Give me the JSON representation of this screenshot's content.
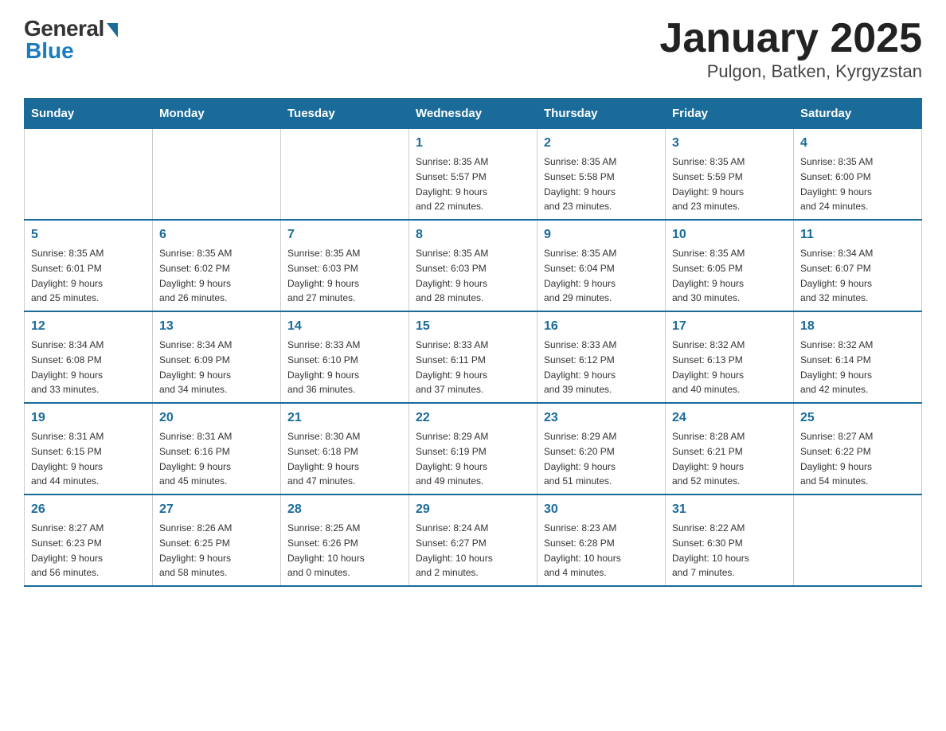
{
  "logo": {
    "general": "General",
    "blue": "Blue"
  },
  "title": "January 2025",
  "subtitle": "Pulgon, Batken, Kyrgyzstan",
  "days_of_week": [
    "Sunday",
    "Monday",
    "Tuesday",
    "Wednesday",
    "Thursday",
    "Friday",
    "Saturday"
  ],
  "weeks": [
    [
      {
        "day": "",
        "info": ""
      },
      {
        "day": "",
        "info": ""
      },
      {
        "day": "",
        "info": ""
      },
      {
        "day": "1",
        "info": "Sunrise: 8:35 AM\nSunset: 5:57 PM\nDaylight: 9 hours\nand 22 minutes."
      },
      {
        "day": "2",
        "info": "Sunrise: 8:35 AM\nSunset: 5:58 PM\nDaylight: 9 hours\nand 23 minutes."
      },
      {
        "day": "3",
        "info": "Sunrise: 8:35 AM\nSunset: 5:59 PM\nDaylight: 9 hours\nand 23 minutes."
      },
      {
        "day": "4",
        "info": "Sunrise: 8:35 AM\nSunset: 6:00 PM\nDaylight: 9 hours\nand 24 minutes."
      }
    ],
    [
      {
        "day": "5",
        "info": "Sunrise: 8:35 AM\nSunset: 6:01 PM\nDaylight: 9 hours\nand 25 minutes."
      },
      {
        "day": "6",
        "info": "Sunrise: 8:35 AM\nSunset: 6:02 PM\nDaylight: 9 hours\nand 26 minutes."
      },
      {
        "day": "7",
        "info": "Sunrise: 8:35 AM\nSunset: 6:03 PM\nDaylight: 9 hours\nand 27 minutes."
      },
      {
        "day": "8",
        "info": "Sunrise: 8:35 AM\nSunset: 6:03 PM\nDaylight: 9 hours\nand 28 minutes."
      },
      {
        "day": "9",
        "info": "Sunrise: 8:35 AM\nSunset: 6:04 PM\nDaylight: 9 hours\nand 29 minutes."
      },
      {
        "day": "10",
        "info": "Sunrise: 8:35 AM\nSunset: 6:05 PM\nDaylight: 9 hours\nand 30 minutes."
      },
      {
        "day": "11",
        "info": "Sunrise: 8:34 AM\nSunset: 6:07 PM\nDaylight: 9 hours\nand 32 minutes."
      }
    ],
    [
      {
        "day": "12",
        "info": "Sunrise: 8:34 AM\nSunset: 6:08 PM\nDaylight: 9 hours\nand 33 minutes."
      },
      {
        "day": "13",
        "info": "Sunrise: 8:34 AM\nSunset: 6:09 PM\nDaylight: 9 hours\nand 34 minutes."
      },
      {
        "day": "14",
        "info": "Sunrise: 8:33 AM\nSunset: 6:10 PM\nDaylight: 9 hours\nand 36 minutes."
      },
      {
        "day": "15",
        "info": "Sunrise: 8:33 AM\nSunset: 6:11 PM\nDaylight: 9 hours\nand 37 minutes."
      },
      {
        "day": "16",
        "info": "Sunrise: 8:33 AM\nSunset: 6:12 PM\nDaylight: 9 hours\nand 39 minutes."
      },
      {
        "day": "17",
        "info": "Sunrise: 8:32 AM\nSunset: 6:13 PM\nDaylight: 9 hours\nand 40 minutes."
      },
      {
        "day": "18",
        "info": "Sunrise: 8:32 AM\nSunset: 6:14 PM\nDaylight: 9 hours\nand 42 minutes."
      }
    ],
    [
      {
        "day": "19",
        "info": "Sunrise: 8:31 AM\nSunset: 6:15 PM\nDaylight: 9 hours\nand 44 minutes."
      },
      {
        "day": "20",
        "info": "Sunrise: 8:31 AM\nSunset: 6:16 PM\nDaylight: 9 hours\nand 45 minutes."
      },
      {
        "day": "21",
        "info": "Sunrise: 8:30 AM\nSunset: 6:18 PM\nDaylight: 9 hours\nand 47 minutes."
      },
      {
        "day": "22",
        "info": "Sunrise: 8:29 AM\nSunset: 6:19 PM\nDaylight: 9 hours\nand 49 minutes."
      },
      {
        "day": "23",
        "info": "Sunrise: 8:29 AM\nSunset: 6:20 PM\nDaylight: 9 hours\nand 51 minutes."
      },
      {
        "day": "24",
        "info": "Sunrise: 8:28 AM\nSunset: 6:21 PM\nDaylight: 9 hours\nand 52 minutes."
      },
      {
        "day": "25",
        "info": "Sunrise: 8:27 AM\nSunset: 6:22 PM\nDaylight: 9 hours\nand 54 minutes."
      }
    ],
    [
      {
        "day": "26",
        "info": "Sunrise: 8:27 AM\nSunset: 6:23 PM\nDaylight: 9 hours\nand 56 minutes."
      },
      {
        "day": "27",
        "info": "Sunrise: 8:26 AM\nSunset: 6:25 PM\nDaylight: 9 hours\nand 58 minutes."
      },
      {
        "day": "28",
        "info": "Sunrise: 8:25 AM\nSunset: 6:26 PM\nDaylight: 10 hours\nand 0 minutes."
      },
      {
        "day": "29",
        "info": "Sunrise: 8:24 AM\nSunset: 6:27 PM\nDaylight: 10 hours\nand 2 minutes."
      },
      {
        "day": "30",
        "info": "Sunrise: 8:23 AM\nSunset: 6:28 PM\nDaylight: 10 hours\nand 4 minutes."
      },
      {
        "day": "31",
        "info": "Sunrise: 8:22 AM\nSunset: 6:30 PM\nDaylight: 10 hours\nand 7 minutes."
      },
      {
        "day": "",
        "info": ""
      }
    ]
  ]
}
